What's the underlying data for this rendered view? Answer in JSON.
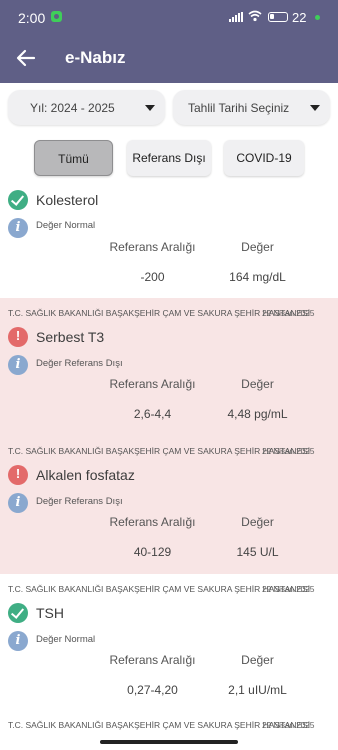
{
  "status_bar": {
    "time": "2:00",
    "battery": "22"
  },
  "app_bar": {
    "title": "e-Nabız"
  },
  "filters": {
    "year": "Yıl: 2024 - 2025",
    "date": "Tahlil Tarihi Seçiniz"
  },
  "tabs": [
    {
      "label": "Tümü"
    },
    {
      "label": "Referans Dışı"
    },
    {
      "label": "COVID-19"
    }
  ],
  "labels": {
    "ref_range": "Referans Aralığı",
    "value": "Değer"
  },
  "results": [
    {
      "hospital": "",
      "date": "",
      "name": "Kolesterol",
      "status": "Değer Normal",
      "ref": "-200",
      "value": "164 mg/dL"
    },
    {
      "hospital": "T.C. SAĞLIK BAKANLIĞI BAŞAKŞEHİR ÇAM VE SAKURA ŞEHİR HASTANESİ",
      "date": "22 Nisan 2025",
      "name": "Serbest T3",
      "status": "Değer Referans Dışı",
      "ref": "2,6-4,4",
      "value": "4,48 pg/mL"
    },
    {
      "hospital": "T.C. SAĞLIK BAKANLIĞI BAŞAKŞEHİR ÇAM VE SAKURA ŞEHİR HASTANESİ",
      "date": "22 Nisan 2025",
      "name": "Alkalen fosfataz",
      "status": "Değer Referans Dışı",
      "ref": "40-129",
      "value": "145 U/L"
    },
    {
      "hospital": "T.C. SAĞLIK BAKANLIĞI BAŞAKŞEHİR ÇAM VE SAKURA ŞEHİR HASTANESİ",
      "date": "22 Nisan 2025",
      "name": "TSH",
      "status": "Değer Normal",
      "ref": "0,27-4,20",
      "value": "2,1 uIU/mL"
    }
  ],
  "next_item": {
    "hospital": "T.C. SAĞLIK BAKANLIĞI BAŞAKŞEHİR ÇAM VE SAKURA ŞEHİR HASTANESİ",
    "date": "22 Nisan 2025"
  },
  "colors": {
    "app_bar": "#5f5f86",
    "abnormal_bg": "#f8e5e5",
    "normal_icon": "#3fae84",
    "warning_icon": "#e36a6a",
    "info_icon": "#8aa8cf"
  }
}
